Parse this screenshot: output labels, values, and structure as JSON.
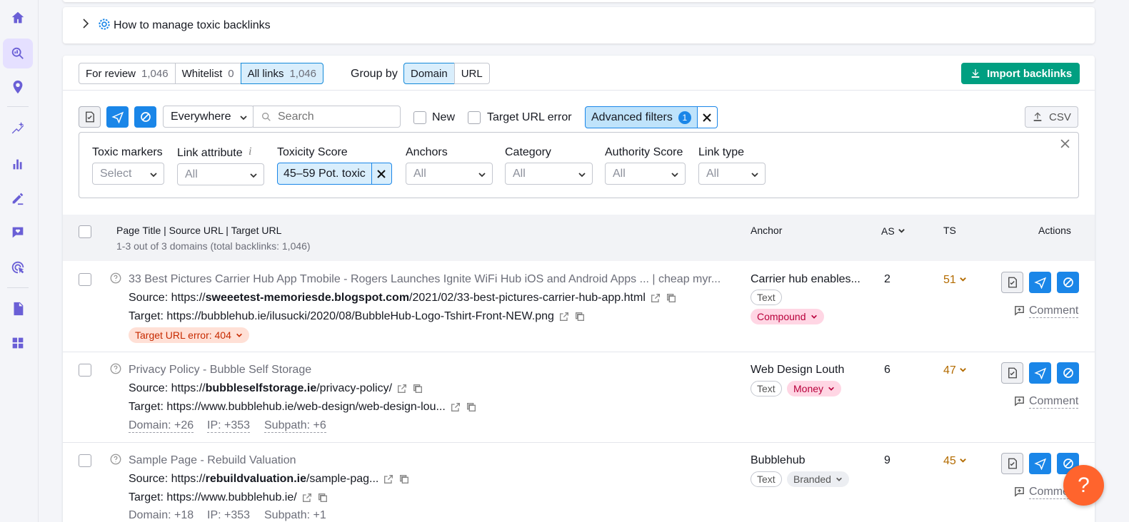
{
  "sidebar": {
    "icons": [
      "home-icon",
      "backlink-audit-icon",
      "location-icon",
      "ai-sparkle-icon",
      "bar-chart-icon",
      "edit-icon",
      "heart-message-icon",
      "target-cursor-icon",
      "document-icon",
      "apps-grid-icon"
    ]
  },
  "accordion": {
    "title": "How to manage toxic backlinks"
  },
  "tabs": {
    "for_review": {
      "label": "For review",
      "count": "1,046"
    },
    "whitelist": {
      "label": "Whitelist",
      "count": "0"
    },
    "all_links": {
      "label": "All links",
      "count": "1,046"
    }
  },
  "group_by": {
    "label": "Group by",
    "domain": "Domain",
    "url": "URL"
  },
  "import_button": "Import backlinks",
  "toolbar": {
    "scope": "Everywhere",
    "search_placeholder": "Search",
    "new_label": "New",
    "target_error_label": "Target URL error",
    "advanced_filters": "Advanced filters",
    "advanced_count": "1",
    "csv": "CSV"
  },
  "filters": {
    "toxic_markers": {
      "label": "Toxic markers",
      "value": "Select"
    },
    "link_attribute": {
      "label": "Link attribute",
      "info": "i",
      "value": "All"
    },
    "toxicity_score": {
      "label": "Toxicity Score",
      "value": "45–59 Pot. toxic"
    },
    "anchors": {
      "label": "Anchors",
      "value": "All"
    },
    "category": {
      "label": "Category",
      "value": "All"
    },
    "authority_score": {
      "label": "Authority Score",
      "value": "All"
    },
    "link_type": {
      "label": "Link type",
      "value": "All"
    }
  },
  "table": {
    "col_page": "Page Title | Source URL | Target URL",
    "summary": "1-3 out of 3 domains (total backlinks: 1,046)",
    "col_anchor": "Anchor",
    "col_as": "AS",
    "col_ts": "TS",
    "col_actions": "Actions",
    "comment_label": "Comment",
    "rows": [
      {
        "title": "33 Best Pictures Carrier Hub App Tmobile - Rogers Launches Ignite WiFi Hub iOS and Android Apps ... | cheap myr...",
        "source_prefix": "Source: ",
        "source_pre": "https://",
        "source_domain": "sweeetest-memoriesde.blogspot.com",
        "source_path": "/2021/02/33-best-pictures-carrier-hub-app.html",
        "target_prefix": "Target: ",
        "target": "https://bubblehub.ie/ilusucki/2020/08/BubbleHub-Logo-Tshirt-Front-NEW.png",
        "error": "Target URL error: 404",
        "anchor": "Carrier hub enables...",
        "tag1": "Text",
        "tag2": "Compound",
        "as": "2",
        "ts": "51"
      },
      {
        "title": "Privacy Policy - Bubble Self Storage",
        "source_prefix": "Source: ",
        "source_pre": "https://",
        "source_domain": "bubbleselfstorage.ie",
        "source_path": "/privacy-policy/",
        "target_prefix": "Target: ",
        "target": "https://www.bubblehub.ie/web-design/web-design-lou...",
        "domain_meta": "Domain: +26",
        "ip_meta": "IP: +353",
        "subpath_meta": "Subpath: +6",
        "anchor": "Web Design Louth",
        "tag1": "Text",
        "tag2": "Money",
        "as": "6",
        "ts": "47"
      },
      {
        "title": "Sample Page - Rebuild Valuation",
        "source_prefix": "Source: ",
        "source_pre": "https://",
        "source_domain": "rebuildvaluation.ie",
        "source_path": "/sample-pag...",
        "target_prefix": "Target: ",
        "target": "https://www.bubblehub.ie/",
        "domain_meta": "Domain: +18",
        "ip_meta": "IP: +353",
        "subpath_meta": "Subpath: +1",
        "anchor": "Bubblehub",
        "tag1": "Text",
        "tag2": "Branded",
        "as": "9",
        "ts": "45",
        "comment": "Comme"
      }
    ]
  },
  "help": "?",
  "colors": {
    "accent": "#1a86e8",
    "green": "#009f81",
    "ts": "#b36b00",
    "purple": "#6a5fd6"
  }
}
